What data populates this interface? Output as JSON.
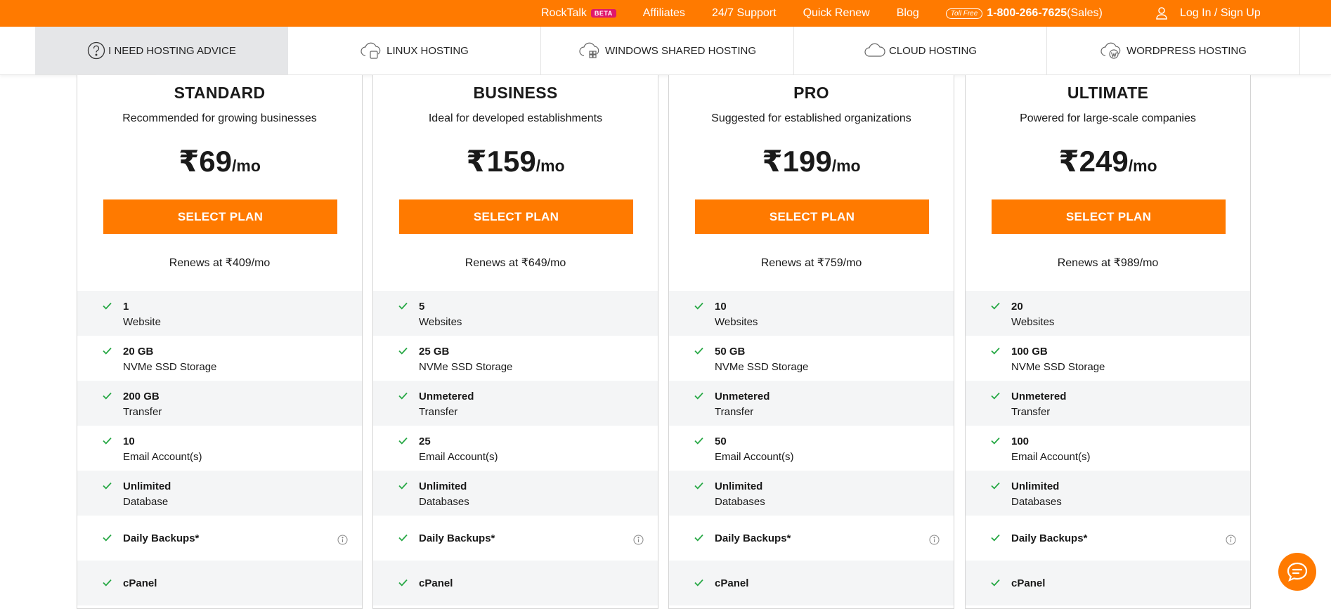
{
  "topbar": {
    "rocktalk": "RockTalk",
    "beta": "BETA",
    "affiliates": "Affiliates",
    "support": "24/7 Support",
    "quick_renew": "Quick Renew",
    "blog": "Blog",
    "toll_free": "Toll Free",
    "phone": "1-800-266-7625",
    "phone_suffix": "(Sales)",
    "login": "Log In / Sign Up",
    "color": "#ff7a00"
  },
  "tabs": [
    {
      "label": "I NEED HOSTING ADVICE",
      "icon": "question-icon"
    },
    {
      "label": "LINUX HOSTING",
      "icon": "linux-cloud-icon"
    },
    {
      "label": "WINDOWS SHARED HOSTING",
      "icon": "windows-cloud-icon"
    },
    {
      "label": "CLOUD HOSTING",
      "icon": "cloud-icon"
    },
    {
      "label": "WORDPRESS HOSTING",
      "icon": "wordpress-cloud-icon"
    }
  ],
  "plans": [
    {
      "name": "STANDARD",
      "desc": "Recommended for growing businesses",
      "price": "₹69",
      "per": "/mo",
      "button": "SELECT PLAN",
      "renews": "Renews at ₹409/mo",
      "features": [
        {
          "value": "1",
          "label": "Website"
        },
        {
          "value": "20 GB",
          "label": "NVMe SSD Storage"
        },
        {
          "value": "200 GB",
          "label": "Transfer"
        },
        {
          "value": "10",
          "label": "Email Account(s)"
        },
        {
          "value": "Unlimited",
          "label": "Database"
        },
        {
          "value": "Daily Backups*",
          "label": ""
        },
        {
          "value": "cPanel",
          "label": ""
        }
      ]
    },
    {
      "name": "BUSINESS",
      "desc": "Ideal for developed establishments",
      "price": "₹159",
      "per": "/mo",
      "button": "SELECT PLAN",
      "renews": "Renews at ₹649/mo",
      "features": [
        {
          "value": "5",
          "label": "Websites"
        },
        {
          "value": "25 GB",
          "label": "NVMe SSD Storage"
        },
        {
          "value": "Unmetered",
          "label": "Transfer"
        },
        {
          "value": "25",
          "label": "Email Account(s)"
        },
        {
          "value": "Unlimited",
          "label": "Databases"
        },
        {
          "value": "Daily Backups*",
          "label": ""
        },
        {
          "value": "cPanel",
          "label": ""
        }
      ]
    },
    {
      "name": "PRO",
      "desc": "Suggested for established organizations",
      "price": "₹199",
      "per": "/mo",
      "button": "SELECT PLAN",
      "renews": "Renews at ₹759/mo",
      "features": [
        {
          "value": "10",
          "label": "Websites"
        },
        {
          "value": "50 GB",
          "label": "NVMe SSD Storage"
        },
        {
          "value": "Unmetered",
          "label": "Transfer"
        },
        {
          "value": "50",
          "label": "Email Account(s)"
        },
        {
          "value": "Unlimited",
          "label": "Databases"
        },
        {
          "value": "Daily Backups*",
          "label": ""
        },
        {
          "value": "cPanel",
          "label": ""
        }
      ]
    },
    {
      "name": "ULTIMATE",
      "desc": "Powered for large-scale companies",
      "price": "₹249",
      "per": "/mo",
      "button": "SELECT PLAN",
      "renews": "Renews at ₹989/mo",
      "features": [
        {
          "value": "20",
          "label": "Websites"
        },
        {
          "value": "100 GB",
          "label": "NVMe SSD Storage"
        },
        {
          "value": "Unmetered",
          "label": "Transfer"
        },
        {
          "value": "100",
          "label": "Email Account(s)"
        },
        {
          "value": "Unlimited",
          "label": "Databases"
        },
        {
          "value": "Daily Backups*",
          "label": ""
        },
        {
          "value": "cPanel",
          "label": ""
        }
      ]
    }
  ]
}
